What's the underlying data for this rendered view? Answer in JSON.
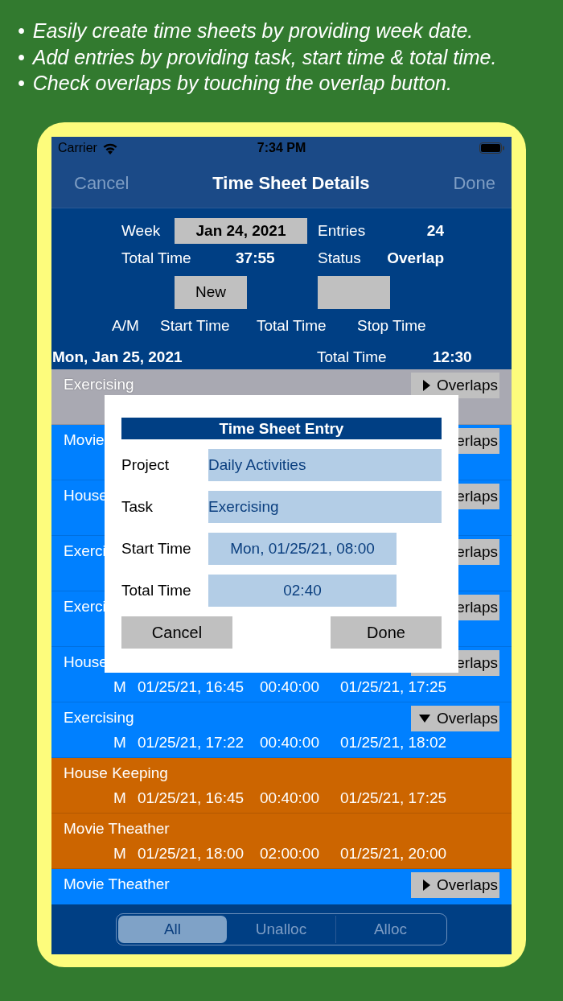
{
  "captions": [
    {
      "bullet": "•",
      "text": "Easily create time sheets by providing week date."
    },
    {
      "bullet": "•",
      "text": "Add entries by providing task, start time & total time."
    },
    {
      "bullet": "•",
      "text": "Check overlaps by touching the overlap button."
    }
  ],
  "status_bar": {
    "carrier": "Carrier",
    "time": "7:34 PM"
  },
  "nav": {
    "cancel": {
      "label": "Cancel",
      "disabled": true
    },
    "title": "Time Sheet Details",
    "done": {
      "label": "Done",
      "disabled": true
    }
  },
  "summary": {
    "week_label": "Week",
    "week_value": "Jan 24, 2021",
    "entries_label": "Entries",
    "entries_value": "24",
    "total_label": "Total Time",
    "total_value": "37:55",
    "status_label": "Status",
    "status_value": "Overlap",
    "new_button": "New"
  },
  "columns": [
    "A/M",
    "Start Time",
    "Total Time",
    "Stop Time"
  ],
  "day_header": {
    "date": "Mon, Jan 25, 2021",
    "total_label": "Total Time",
    "total_value": "12:30"
  },
  "rows": [
    {
      "kind": "entry",
      "selected": true,
      "title": "Exercising",
      "overlaps_button": {
        "label": "Overlaps",
        "expanded": false
      }
    },
    {
      "kind": "entry",
      "selected": false,
      "title": "Movie",
      "overlaps_button": {
        "label": "erlaps"
      }
    },
    {
      "kind": "entry",
      "selected": false,
      "title": "House",
      "overlaps_button": {
        "label": "erlaps"
      }
    },
    {
      "kind": "entry",
      "selected": false,
      "title": "Exerci",
      "overlaps_button": {
        "label": "erlaps"
      }
    },
    {
      "kind": "entry",
      "selected": false,
      "title": "Exerci",
      "overlaps_button": {
        "label": "erlaps"
      }
    },
    {
      "kind": "entry",
      "selected": false,
      "title": "House",
      "overlaps_button": {
        "label": "erlaps"
      },
      "detail": {
        "am": "M",
        "start": "01/25/21, 16:45",
        "total": "00:40:00",
        "stop": "01/25/21, 17:25"
      }
    },
    {
      "kind": "entry",
      "selected": false,
      "title": "Exercising",
      "overlaps_button": {
        "label": "Overlaps",
        "expanded": true
      },
      "detail": {
        "am": "M",
        "start": "01/25/21, 17:22",
        "total": "00:40:00",
        "stop": "01/25/21, 18:02"
      }
    },
    {
      "kind": "overlap",
      "selected": false,
      "title": "House Keeping",
      "detail": {
        "am": "M",
        "start": "01/25/21, 16:45",
        "total": "00:40:00",
        "stop": "01/25/21, 17:25"
      }
    },
    {
      "kind": "overlap",
      "selected": false,
      "title": "Movie Theather",
      "detail": {
        "am": "M",
        "start": "01/25/21, 18:00",
        "total": "02:00:00",
        "stop": "01/25/21, 20:00"
      }
    },
    {
      "kind": "entry",
      "selected": false,
      "title": "Movie Theather",
      "overlaps_button": {
        "label": "Overlaps",
        "expanded": false
      }
    }
  ],
  "dialog": {
    "title": "Time Sheet Entry",
    "fields": [
      {
        "kind": "text",
        "label": "Project",
        "value": "Daily Activities"
      },
      {
        "kind": "text",
        "label": "Task",
        "value": "Exercising"
      },
      {
        "kind": "time",
        "label": "Start Time",
        "value": "Mon, 01/25/21, 08:00"
      },
      {
        "kind": "time",
        "label": "Total Time",
        "value": "02:40"
      }
    ],
    "cancel": "Cancel",
    "done": "Done"
  },
  "filter_tabs": [
    {
      "label": "All",
      "selected": true
    },
    {
      "label": "Unalloc",
      "selected": false
    },
    {
      "label": "Alloc",
      "selected": false
    }
  ]
}
